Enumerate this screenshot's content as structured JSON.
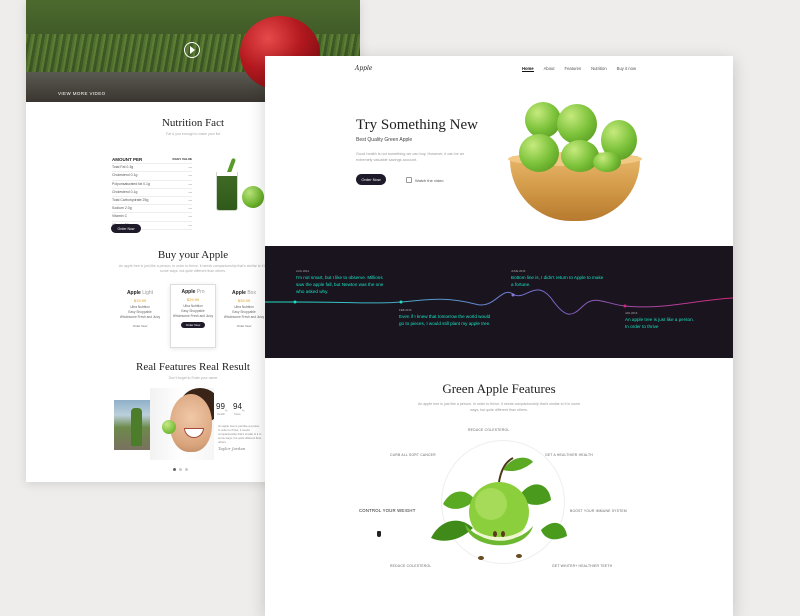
{
  "back_page": {
    "video_label": "VIEW MORE VIDEO",
    "nutrition": {
      "title": "Nutrition Fact",
      "subtitle": "Fat & you enough to make your list",
      "header_left": "AMOUNT PER",
      "header_right": "DAILY VALUE",
      "rows": [
        "Total Fat 0.3g",
        "Cholesterol 0.1g",
        "Polyunsaturated fat 0.1g",
        "Cholesterol 0.1g",
        "Total Carbohydrate 25g",
        "Sodium 2.0g",
        "Vitamin C",
        "Vitamin B6"
      ],
      "button": "Order Now"
    },
    "buy": {
      "title": "Buy your Apple",
      "subtitle": "An apple tree is just like a person. In order to thrive, it needs companionship that's similar to it in some ways, but quite different than others.",
      "plans": [
        {
          "name": "Apple",
          "variant": "Light",
          "price": "$19.99",
          "features": [
            "Ultra Nutrition",
            "Easy Shoppable",
            "Wholesome Fresh and Juicy"
          ],
          "button": "Order Now"
        },
        {
          "name": "Apple",
          "variant": "Pro",
          "price": "$29.99",
          "features": [
            "Ultra Nutrition",
            "Easy Shoppable",
            "Wholesome Fresh and Juicy"
          ],
          "button": "Order Now"
        },
        {
          "name": "Apple",
          "variant": "Box",
          "price": "$39.99",
          "features": [
            "Ultra Nutrition",
            "Easy Shoppable",
            "Wholesome Fresh and Juicy"
          ],
          "button": "Order Now"
        }
      ]
    },
    "real": {
      "title": "Real Features Real Result",
      "subtitle": "Don't forget to Enter your name",
      "stat1_value": "99",
      "stat1_unit": "%",
      "stat1_label": "Health",
      "stat2_value": "94",
      "stat2_unit": "%",
      "stat2_label": "Taste",
      "quote": "An apple tree is just like a person. In order to thrive, it needs companionship that's similar to it in some ways, but quite different than others.",
      "signature": "Taylor Jordan"
    }
  },
  "front_page": {
    "logo": "Apple",
    "nav": [
      "Home",
      "About",
      "Features",
      "Nutrition",
      "Buy it now"
    ],
    "hero": {
      "title": "Try Something New",
      "subtitle": "Best Quality Green Apple",
      "description": "Good health is not something we can buy. However, it can be an extremely valuable savings account.",
      "button": "Order Now",
      "watch": "Watch the video"
    },
    "timeline": [
      {
        "date": "AUG 2014",
        "text": "I'm not smart, but I like to observe. Millions saw the apple fall, but Newton was the one who asked why."
      },
      {
        "date": "FEB 2016",
        "text": "Even if I knew that tomorrow the world would go to pieces, I would still plant my apple tree."
      },
      {
        "date": "JUNE 2016",
        "text": "Bottom line is, I didn't return to Apple to make a fortune."
      },
      {
        "date": "JAN 2016",
        "text": "An apple tree is just like a person. In order to thrive"
      }
    ],
    "features": {
      "title": "Green Apple Features",
      "description": "An apple tree is just like a person. In order to thrive, it needs companionship that's similar to it in some ways, but quite different than others.",
      "labels": {
        "top": "REDUCE COLESTEROL",
        "top_left": "CURB ALL SORT CANCER",
        "top_right": "GET A HEALTHIER HEALTH",
        "left": "CONTROL YOUR WEIGHT",
        "right": "BOOST YOUR IMMUNE SYSTEM",
        "bottom_left": "REDUCE COLESTEROL",
        "bottom_right": "GET WHITER+ HEALTHIER TEETH"
      }
    },
    "colors": {
      "accent": "#1ee0c0",
      "timeline_bg": "#19141e",
      "magenta": "#c0286f"
    }
  }
}
